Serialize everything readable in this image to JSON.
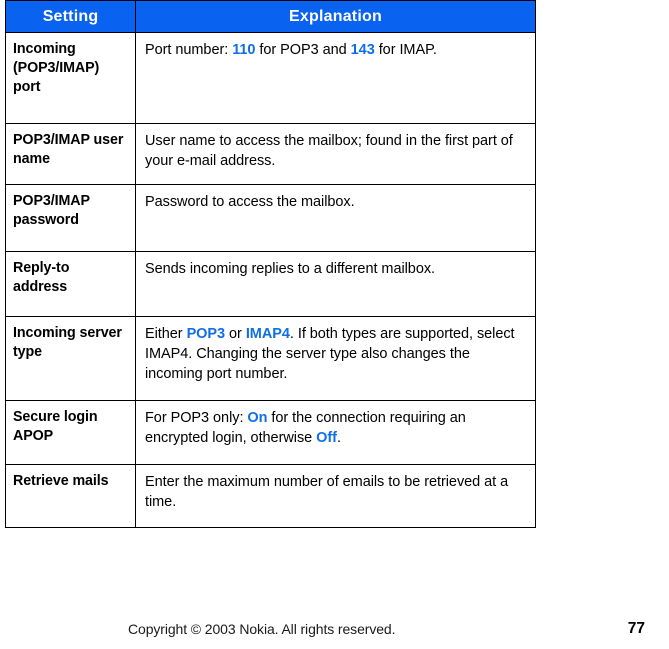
{
  "document": {
    "page_number": "77",
    "copyright": "Copyright © 2003 Nokia. All rights reserved."
  },
  "colors": {
    "header_background": "#0a62f0",
    "header_text": "#ffffff",
    "value_accent": "#0f6fe8",
    "border": "#000000",
    "page_background": "#ffffff"
  },
  "table": {
    "columns": [
      {
        "key": "setting",
        "label": "Setting"
      },
      {
        "key": "explanation",
        "label": "Explanation"
      }
    ],
    "rows": [
      {
        "setting": "Incoming (POP3/IMAP) port",
        "explanation_segments": [
          {
            "text": "Port number: ",
            "accent": false
          },
          {
            "text": "110",
            "accent": true
          },
          {
            "text": " for POP3 and ",
            "accent": false
          },
          {
            "text": "143",
            "accent": true
          },
          {
            "text": " for IMAP.",
            "accent": false
          }
        ],
        "explanation_plain": "Port number: 110 for POP3 and 143 for IMAP."
      },
      {
        "setting": "POP3/IMAP user name",
        "explanation_segments": [
          {
            "text": "User name to access the mailbox; found in the first part of your e-mail address.",
            "accent": false
          }
        ],
        "explanation_plain": "User name to access the mailbox; found in the first part of your e-mail address."
      },
      {
        "setting": "POP3/IMAP password",
        "explanation_segments": [
          {
            "text": "Password to access the mailbox.",
            "accent": false
          }
        ],
        "explanation_plain": "Password to access the mailbox."
      },
      {
        "setting": "Reply-to address",
        "explanation_segments": [
          {
            "text": "Sends incoming replies to a different mailbox.",
            "accent": false
          }
        ],
        "explanation_plain": "Sends incoming replies to a different mailbox."
      },
      {
        "setting": "Incoming server type",
        "explanation_segments": [
          {
            "text": "Either ",
            "accent": false
          },
          {
            "text": "POP3",
            "accent": true
          },
          {
            "text": " or ",
            "accent": false
          },
          {
            "text": "IMAP4",
            "accent": true
          },
          {
            "text": ". If both types are supported, select IMAP4. Changing the server type also changes the incoming port number.",
            "accent": false
          }
        ],
        "explanation_plain": "Either POP3 or IMAP4. If both types are supported, select IMAP4. Changing the server type also changes the incoming port number."
      },
      {
        "setting": "Secure login APOP",
        "explanation_segments": [
          {
            "text": "For POP3 only: ",
            "accent": false
          },
          {
            "text": "On",
            "accent": true
          },
          {
            "text": " for the connection requiring an encrypted login, otherwise ",
            "accent": false
          },
          {
            "text": "Off",
            "accent": true
          },
          {
            "text": ".",
            "accent": false
          }
        ],
        "explanation_plain": "For POP3 only: On for the connection requiring an encrypted login, otherwise Off."
      },
      {
        "setting": "Retrieve mails",
        "explanation_segments": [
          {
            "text": "Enter the maximum number of emails to be retrieved at a time.",
            "accent": false
          }
        ],
        "explanation_plain": "Enter the maximum number of emails to be retrieved at a time."
      }
    ]
  }
}
